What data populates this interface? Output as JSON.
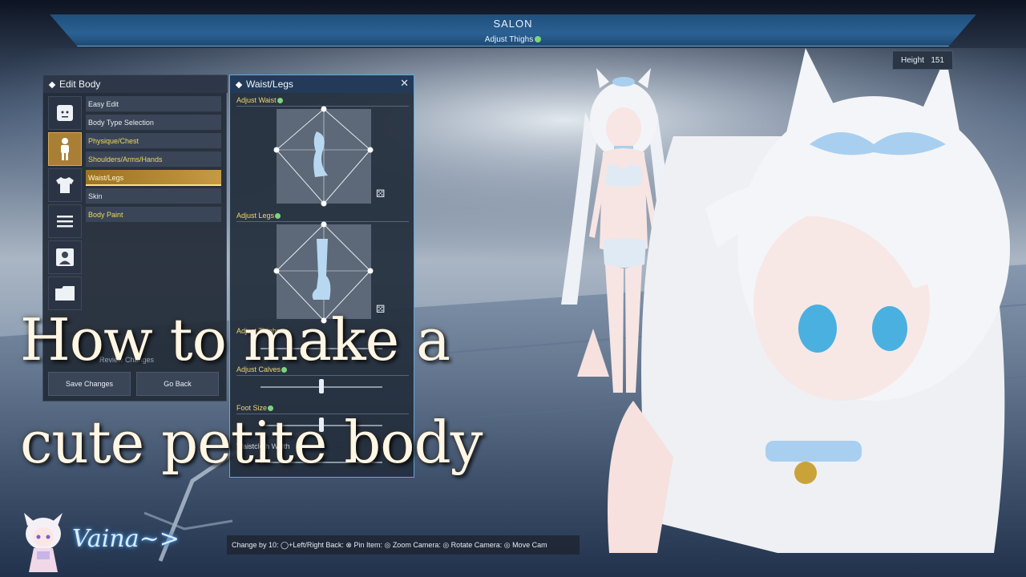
{
  "window": {
    "title": "SALON",
    "subtitle": "Adjust Thighs"
  },
  "height_display": {
    "label": "Height",
    "value": "151"
  },
  "edit_body": {
    "title": "Edit Body",
    "categories": [
      {
        "icon": "face-icon",
        "active": false
      },
      {
        "icon": "body-figure-icon",
        "active": true
      },
      {
        "icon": "shirt-icon",
        "active": false
      },
      {
        "icon": "menu-lines-icon",
        "active": false
      },
      {
        "icon": "user-card-icon",
        "active": false
      },
      {
        "icon": "folder-icon",
        "active": false
      }
    ],
    "menu_items": [
      {
        "label": "Easy Edit",
        "style": "normal"
      },
      {
        "label": "Body Type Selection",
        "style": "normal"
      },
      {
        "label": "Physique/Chest",
        "style": "yellow"
      },
      {
        "label": "Shoulders/Arms/Hands",
        "style": "yellow"
      },
      {
        "label": "Waist/Legs",
        "style": "active"
      },
      {
        "label": "Skin",
        "style": "normal"
      },
      {
        "label": "Body Paint",
        "style": "yellow"
      }
    ],
    "review_label": "Review Changes",
    "save_label": "Save Changes",
    "back_label": "Go Back"
  },
  "waist_legs": {
    "title": "Waist/Legs",
    "close_icon": "close-icon",
    "adjust_waist_label": "Adjust Waist",
    "adjust_legs_label": "Adjust Legs",
    "adjust_thighs_label": "Adjust Thighs",
    "adjust_calves_label": "Adjust Calves",
    "foot_size_label": "Foot Size",
    "waistcloth_label": "Waistcloth Width",
    "calves_slider": 0.5,
    "foot_slider": 0.5
  },
  "overlay": {
    "line1": "How to make a",
    "line2": "cute petite body",
    "signature": "Vaina~>"
  },
  "help_bar": {
    "text": "Change by 10: ◯+Left/Right Back: ⊗ Pin Item: ◎ Zoom Camera: ◎ Rotate Camera: ◎ Move Cam"
  },
  "colors": {
    "accent_gold": "#c69a45",
    "accent_yellow": "#f0d76a",
    "panel_border_blue": "#5ea8d9",
    "bar_blue": "#2b6193"
  }
}
